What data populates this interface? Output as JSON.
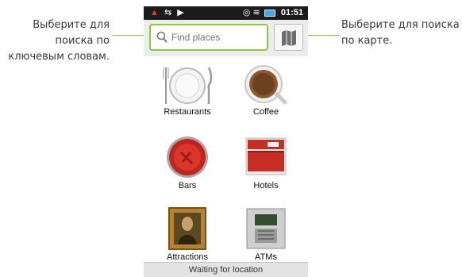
{
  "callouts": {
    "left": [
      "Выберите для",
      "поиска по",
      "ключевым словам."
    ],
    "right": [
      "Выберите для поиска",
      "по карте."
    ]
  },
  "statusbar": {
    "time": "01:51"
  },
  "search": {
    "placeholder": "Find places"
  },
  "categories": [
    {
      "label": "Restaurants",
      "icon": "restaurant-plate-icon"
    },
    {
      "label": "Coffee",
      "icon": "coffee-cup-icon"
    },
    {
      "label": "Bars",
      "icon": "bottle-cap-icon"
    },
    {
      "label": "Hotels",
      "icon": "hotel-bed-icon"
    },
    {
      "label": "Attractions",
      "icon": "mona-lisa-frame-icon"
    },
    {
      "label": "ATMs",
      "icon": "atm-machine-icon"
    }
  ],
  "status_message": "Waiting for location",
  "colors": {
    "callout_line": "#8dc63f",
    "search_border": "#8dc63f"
  }
}
